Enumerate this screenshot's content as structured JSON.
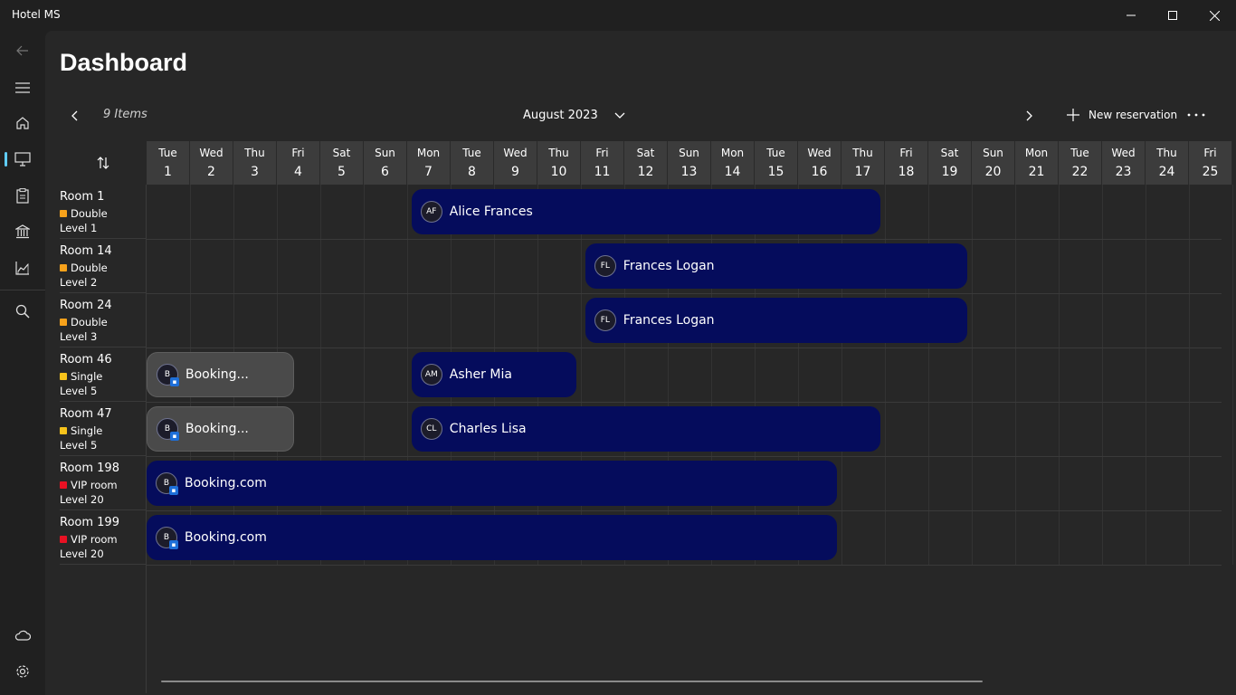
{
  "app": {
    "title": "Hotel MS"
  },
  "page": {
    "title": "Dashboard"
  },
  "toolbar": {
    "items_count": "9 Items",
    "month": "August 2023",
    "new_reservation": "New reservation"
  },
  "nav": {
    "top_icons": [
      "back-arrow-icon",
      "hamburger-menu-icon",
      "home-icon",
      "monitor-icon",
      "clipboard-icon",
      "bank-icon",
      "chart-icon",
      "search-icon"
    ],
    "bottom_icons": [
      "cloud-icon",
      "gear-icon"
    ],
    "selected": "monitor-icon",
    "accent_color": "#60cdff"
  },
  "days": [
    {
      "name": "Tue",
      "num": "1"
    },
    {
      "name": "Wed",
      "num": "2"
    },
    {
      "name": "Thu",
      "num": "3"
    },
    {
      "name": "Fri",
      "num": "4"
    },
    {
      "name": "Sat",
      "num": "5"
    },
    {
      "name": "Sun",
      "num": "6"
    },
    {
      "name": "Mon",
      "num": "7"
    },
    {
      "name": "Tue",
      "num": "8"
    },
    {
      "name": "Wed",
      "num": "9"
    },
    {
      "name": "Thu",
      "num": "10"
    },
    {
      "name": "Fri",
      "num": "11"
    },
    {
      "name": "Sat",
      "num": "12"
    },
    {
      "name": "Sun",
      "num": "13"
    },
    {
      "name": "Mon",
      "num": "14"
    },
    {
      "name": "Tue",
      "num": "15"
    },
    {
      "name": "Wed",
      "num": "16"
    },
    {
      "name": "Thu",
      "num": "17"
    },
    {
      "name": "Fri",
      "num": "18"
    },
    {
      "name": "Sat",
      "num": "19"
    },
    {
      "name": "Sun",
      "num": "20"
    },
    {
      "name": "Mon",
      "num": "21"
    },
    {
      "name": "Tue",
      "num": "22"
    },
    {
      "name": "Wed",
      "num": "23"
    },
    {
      "name": "Thu",
      "num": "24"
    },
    {
      "name": "Fri",
      "num": "25"
    }
  ],
  "rooms": [
    {
      "name": "Room 1",
      "type": "Double",
      "type_color": "#f7a21b",
      "level": "Level 1"
    },
    {
      "name": "Room 14",
      "type": "Double",
      "type_color": "#f7a21b",
      "level": "Level 2"
    },
    {
      "name": "Room 24",
      "type": "Double",
      "type_color": "#f7a21b",
      "level": "Level 3"
    },
    {
      "name": "Room 46",
      "type": "Single",
      "type_color": "#f7c31b",
      "level": "Level 5"
    },
    {
      "name": "Room 47",
      "type": "Single",
      "type_color": "#f7c31b",
      "level": "Level 5"
    },
    {
      "name": "Room 198",
      "type": "VIP room",
      "type_color": "#e81123",
      "level": "Level 20"
    },
    {
      "name": "Room 199",
      "type": "VIP room",
      "type_color": "#e81123",
      "level": "Level 20"
    }
  ],
  "bookings": [
    {
      "room": 0,
      "initials": "AF",
      "label": "Alice Frances",
      "style": "navy",
      "start_day": 7.1,
      "end_day": 16.9
    },
    {
      "room": 1,
      "initials": "FL",
      "label": "Frances Logan",
      "style": "navy",
      "start_day": 11.1,
      "end_day": 18.9
    },
    {
      "room": 2,
      "initials": "FL",
      "label": "Frances Logan",
      "style": "navy",
      "start_day": 11.1,
      "end_day": 18.9
    },
    {
      "room": 3,
      "initials": "B",
      "label": "Booking...",
      "style": "grey",
      "start_day": 1,
      "end_day": 3.4,
      "badge": true
    },
    {
      "room": 3,
      "initials": "AM",
      "label": "Asher Mia",
      "style": "navy",
      "start_day": 7.1,
      "end_day": 9.9
    },
    {
      "room": 4,
      "initials": "B",
      "label": "Booking...",
      "style": "grey",
      "start_day": 1,
      "end_day": 3.4,
      "badge": true
    },
    {
      "room": 4,
      "initials": "CL",
      "label": "Charles Lisa",
      "style": "navy",
      "start_day": 7.1,
      "end_day": 16.9
    },
    {
      "room": 5,
      "initials": "B",
      "label": "Booking.com",
      "style": "navy",
      "start_day": 1,
      "end_day": 15.9,
      "badge": true
    },
    {
      "room": 6,
      "initials": "B",
      "label": "Booking.com",
      "style": "navy",
      "start_day": 1,
      "end_day": 15.9,
      "badge": true
    }
  ],
  "colors": {
    "booking_navy": "#050c5c",
    "booking_grey": "#4a4a4a",
    "header_bg": "#3c3c3c"
  }
}
